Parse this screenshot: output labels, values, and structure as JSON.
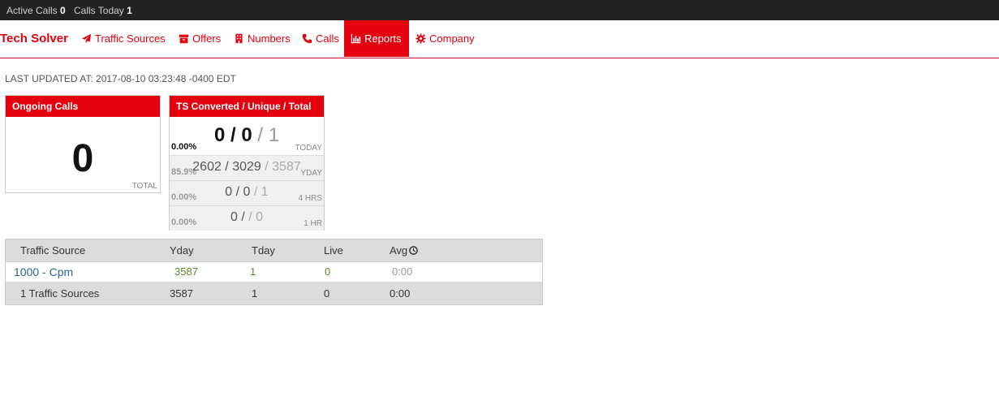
{
  "statusbar": {
    "active_calls_label": "Active Calls",
    "active_calls_value": "0",
    "calls_today_label": "Calls Today",
    "calls_today_value": "1"
  },
  "nav": {
    "brand": "Tech Solver",
    "items": [
      {
        "label": "Traffic Sources",
        "icon": "paper-plane-icon"
      },
      {
        "label": "Offers",
        "icon": "archive-box-icon"
      },
      {
        "label": "Numbers",
        "icon": "building-icon"
      },
      {
        "label": "Calls",
        "icon": "phone-icon"
      },
      {
        "label": "Reports",
        "icon": "bar-chart-icon",
        "active": true
      },
      {
        "label": "Company",
        "icon": "gear-icon"
      }
    ],
    "accent_color": "#e3000f"
  },
  "last_updated": "LAST UPDATED AT: 2017-08-10 03:23:48 -0400 EDT",
  "ongoing": {
    "title": "Ongoing Calls",
    "value": "0",
    "label": "TOTAL"
  },
  "ts": {
    "title": "TS Converted / Unique / Total",
    "rows": [
      {
        "pct": "0.00%",
        "converted": "0",
        "unique": "0",
        "total": "1",
        "label": "TODAY"
      },
      {
        "pct": "85.9%",
        "converted": "2602",
        "unique": "3029",
        "total": "3587",
        "label": "YDAY"
      },
      {
        "pct": "0.00%",
        "converted": "0",
        "unique": "0",
        "total": "1",
        "label": "4 HRS"
      },
      {
        "pct": "0.00%",
        "converted": "0",
        "unique": "",
        "total": "0",
        "label": "1 HR"
      }
    ]
  },
  "table": {
    "headers": [
      "Traffic Source",
      "Yday",
      "Tday",
      "Live",
      "Avg"
    ],
    "rows": [
      {
        "source": "1000 - Cpm",
        "yday": "3587",
        "tday": "1",
        "live": "0",
        "avg": "0:00"
      }
    ],
    "footer": {
      "source": "1 Traffic Sources",
      "yday": "3587",
      "tday": "1",
      "live": "0",
      "avg": "0:00"
    }
  }
}
